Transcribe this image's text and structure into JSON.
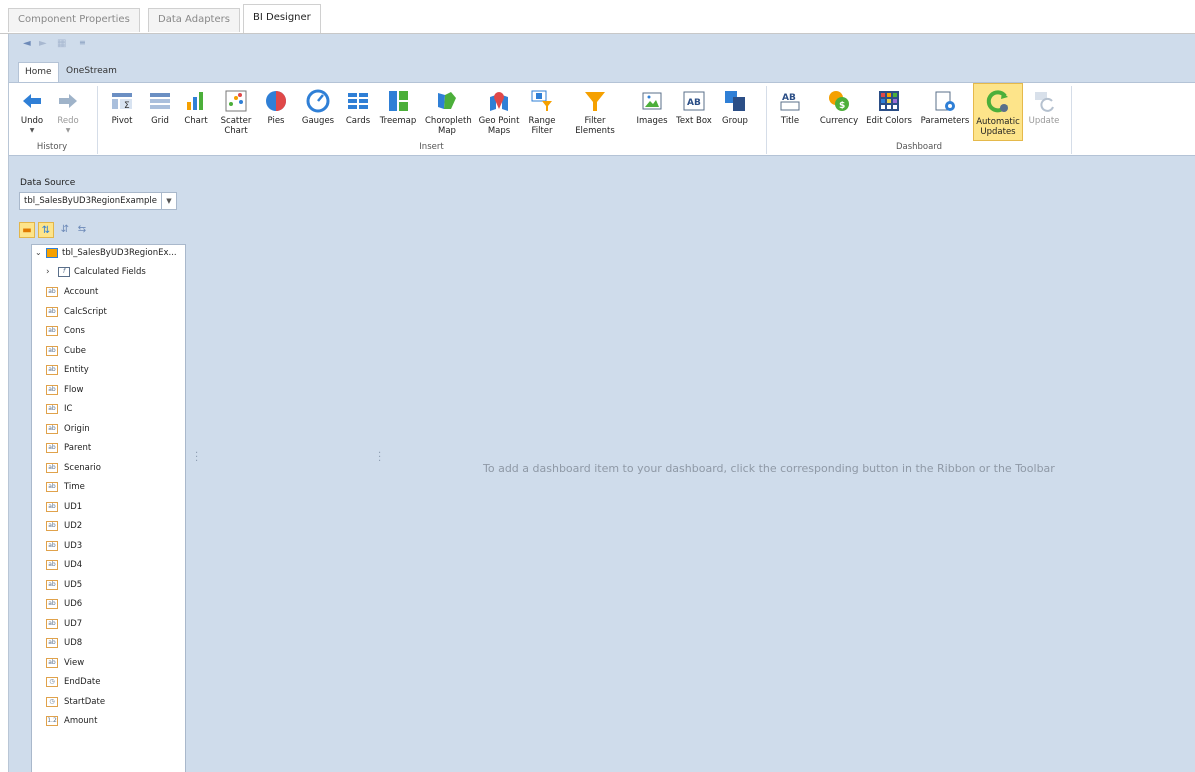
{
  "top_tabs": [
    "Component Properties",
    "Data Adapters",
    "BI Designer"
  ],
  "ribbon_tabs": [
    "Home",
    "OneStream"
  ],
  "ribbon": {
    "history": {
      "label": "History",
      "buttons": [
        "Undo",
        "Redo"
      ]
    },
    "insert": {
      "label": "Insert",
      "buttons": [
        "Pivot",
        "Grid",
        "Chart",
        "Scatter Chart",
        "Pies",
        "Gauges",
        "Cards",
        "Treemap",
        "Choropleth Map",
        "Geo Point Maps",
        "Range Filter",
        "Filter Elements",
        "Images",
        "Text Box",
        "Group"
      ]
    },
    "dashboard": {
      "label": "Dashboard",
      "buttons": [
        "Title",
        "Currency",
        "Edit Colors",
        "Parameters",
        "Automatic Updates",
        "Update"
      ]
    }
  },
  "data_source": {
    "label": "Data Source",
    "value": "tbl_SalesByUD3RegionExample"
  },
  "tree": {
    "root": "tbl_SalesByUD3RegionEx...",
    "calculated": "Calculated Fields",
    "fields": [
      {
        "name": "Account",
        "type": "ab"
      },
      {
        "name": "CalcScript",
        "type": "ab"
      },
      {
        "name": "Cons",
        "type": "ab"
      },
      {
        "name": "Cube",
        "type": "ab"
      },
      {
        "name": "Entity",
        "type": "ab"
      },
      {
        "name": "Flow",
        "type": "ab"
      },
      {
        "name": "IC",
        "type": "ab"
      },
      {
        "name": "Origin",
        "type": "ab"
      },
      {
        "name": "Parent",
        "type": "ab"
      },
      {
        "name": "Scenario",
        "type": "ab"
      },
      {
        "name": "Time",
        "type": "ab"
      },
      {
        "name": "UD1",
        "type": "ab"
      },
      {
        "name": "UD2",
        "type": "ab"
      },
      {
        "name": "UD3",
        "type": "ab"
      },
      {
        "name": "UD4",
        "type": "ab"
      },
      {
        "name": "UD5",
        "type": "ab"
      },
      {
        "name": "UD6",
        "type": "ab"
      },
      {
        "name": "UD7",
        "type": "ab"
      },
      {
        "name": "UD8",
        "type": "ab"
      },
      {
        "name": "View",
        "type": "ab"
      },
      {
        "name": "EndDate",
        "type": "date"
      },
      {
        "name": "StartDate",
        "type": "date"
      },
      {
        "name": "Amount",
        "type": "num"
      }
    ]
  },
  "message": "To add a dashboard item to your dashboard, click the corresponding button in the Ribbon or the Toolbar",
  "colors": {
    "accent_blue": "#2f7fd6",
    "orange": "#f5a000",
    "green": "#4caf3a",
    "highlight": "#fde48a",
    "canvas": "#cfdceb"
  }
}
